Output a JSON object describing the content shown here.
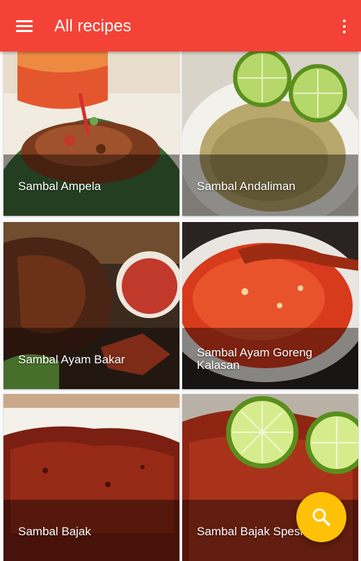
{
  "app_bar": {
    "title": "All recipes",
    "color": "#f44336",
    "menu_icon": "hamburger-menu-icon",
    "overflow_icon": "more-vertical-icon"
  },
  "recipes": [
    {
      "name": "Sambal Ampela"
    },
    {
      "name": "Sambal Andaliman"
    },
    {
      "name": "Sambal Ayam Bakar"
    },
    {
      "name": "Sambal Ayam Goreng Kalasan"
    },
    {
      "name": "Sambal Bajak"
    },
    {
      "name": "Sambal Bajak Spesial"
    }
  ],
  "fab": {
    "icon": "search-icon",
    "color": "#ffc107"
  }
}
